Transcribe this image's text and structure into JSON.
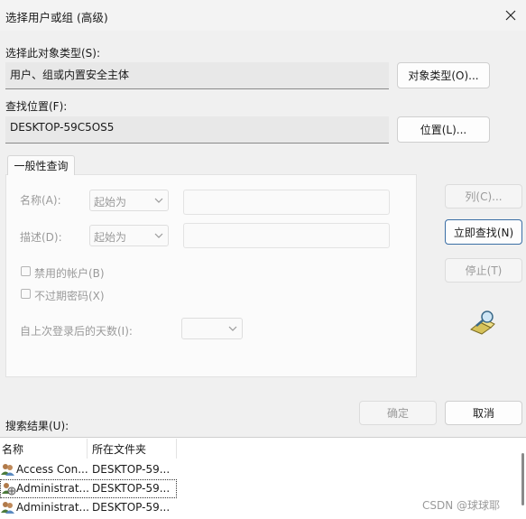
{
  "window": {
    "title": "选择用户或组 (高级)",
    "close_icon": "close-icon"
  },
  "object_type": {
    "label": "选择此对象类型(S):",
    "value": "用户、组或内置安全主体",
    "button": "对象类型(O)..."
  },
  "location": {
    "label": "查找位置(F):",
    "value": "DESKTOP-59C5OS5",
    "button": "位置(L)..."
  },
  "query": {
    "tab": "一般性查询",
    "name_label": "名称(A):",
    "name_mode": "起始为",
    "desc_label": "描述(D):",
    "desc_mode": "起始为",
    "disabled_accounts": "禁用的帐户(B)",
    "non_expiring": "不过期密码(X)",
    "days_label": "自上次登录后的天数(I):",
    "days_value": ""
  },
  "side_buttons": {
    "columns": "列(C)...",
    "find_now": "立即查找(N)",
    "stop": "停止(T)"
  },
  "dialog_buttons": {
    "ok": "确定",
    "cancel": "取消"
  },
  "results": {
    "label": "搜索结果(U):",
    "headers": [
      "名称",
      "所在文件夹"
    ],
    "rows": [
      {
        "name": "Access Con...",
        "folder": "DESKTOP-59..."
      },
      {
        "name": "Administrat...",
        "folder": "DESKTOP-59..."
      },
      {
        "name": "Administrat...",
        "folder": "DESKTOP-59..."
      }
    ]
  },
  "watermark": "CSDN @球球耶"
}
